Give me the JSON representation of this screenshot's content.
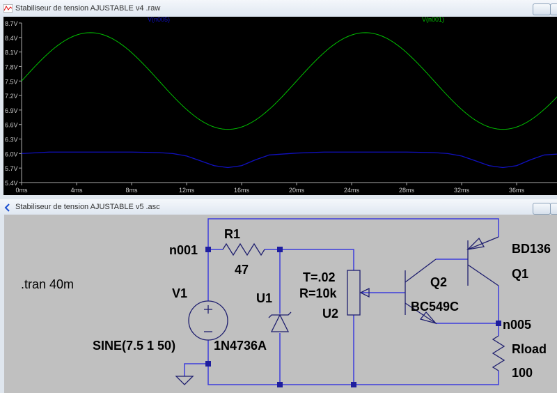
{
  "plot_window": {
    "title": "Stabiliseur de tension AJUSTABLE  v4 .raw"
  },
  "schematic_window": {
    "title": "Stabiliseur de tension AJUSTABLE  v5 .asc"
  },
  "chart_data": {
    "type": "line",
    "xlabel": "",
    "ylabel": "",
    "xlim": [
      0,
      40
    ],
    "ylim": [
      5.4,
      8.7
    ],
    "x_ticks": [
      "0ms",
      "4ms",
      "8ms",
      "12ms",
      "16ms",
      "20ms",
      "24ms",
      "28ms",
      "32ms",
      "36ms"
    ],
    "y_ticks": [
      "8.7V",
      "8.4V",
      "8.1V",
      "7.8V",
      "7.5V",
      "7.2V",
      "6.9V",
      "6.6V",
      "6.3V",
      "6.0V",
      "5.7V",
      "5.4V"
    ],
    "series": [
      {
        "name": "V(n005)",
        "color": "#1010c0",
        "x": [
          0,
          2,
          4,
          6,
          8,
          10,
          11,
          12,
          13,
          14,
          15,
          16,
          17,
          18,
          20,
          22,
          24,
          26,
          28,
          30,
          31,
          32,
          33,
          34,
          35,
          36,
          37,
          38,
          40
        ],
        "y": [
          6.0,
          6.03,
          6.03,
          6.03,
          6.03,
          6.02,
          6.0,
          5.95,
          5.85,
          5.75,
          5.71,
          5.75,
          5.87,
          5.97,
          6.01,
          6.03,
          6.03,
          6.03,
          6.03,
          6.02,
          6.0,
          5.95,
          5.85,
          5.75,
          5.71,
          5.75,
          5.87,
          5.97,
          6.01
        ]
      },
      {
        "name": "V(n001)",
        "color": "#00c000",
        "function": "7.5 + 1*sin(2*pi*50*t)"
      }
    ],
    "background": "#000000"
  },
  "schematic": {
    "directive": ".tran 40m",
    "labels": {
      "n001": "n001",
      "n005": "n005",
      "r1_name": "R1",
      "r1_value": "47",
      "v1_name": "V1",
      "v1_value": "SINE(7.5 1 50)",
      "u1_name": "U1",
      "u1_value": "1N4736A",
      "u2_t": "T=.02",
      "u2_r": "R=10k",
      "u2_name": "U2",
      "q2_name": "Q2",
      "q2_value": "BC549C",
      "q1_name": "Q1",
      "q1_value": "BD136",
      "rload_name": "Rload",
      "rload_value": "100"
    },
    "wire_color": "#3c3cdc"
  }
}
